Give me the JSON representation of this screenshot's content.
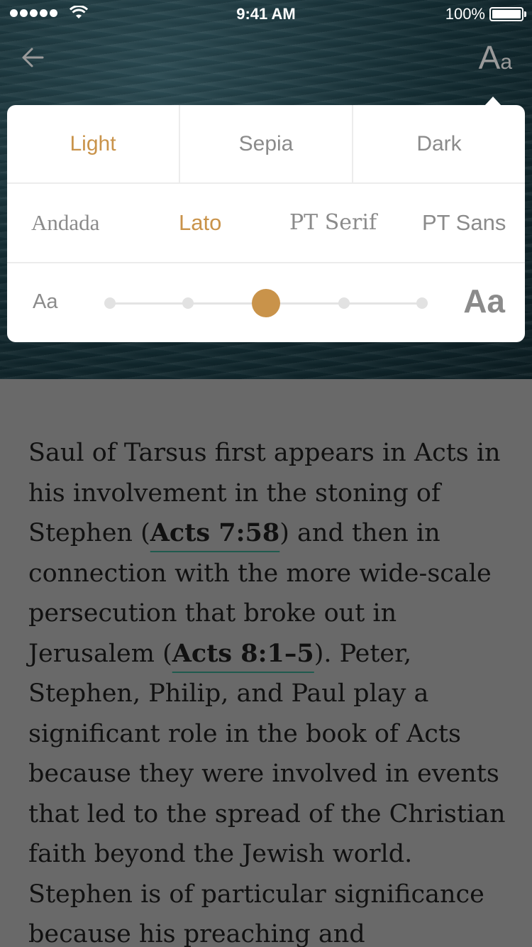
{
  "status_bar": {
    "time": "9:41 AM",
    "battery": "100%"
  },
  "nav": {
    "back_icon": "arrow-left-icon",
    "font_settings_label_big": "A",
    "font_settings_label_small": "a"
  },
  "settings": {
    "themes": [
      {
        "label": "Light",
        "active": true
      },
      {
        "label": "Sepia",
        "active": false
      },
      {
        "label": "Dark",
        "active": false
      }
    ],
    "fonts": [
      {
        "label": "Andada",
        "active": false
      },
      {
        "label": "Lato",
        "active": true
      },
      {
        "label": "PT Serif",
        "active": false
      },
      {
        "label": "PT Sans",
        "active": false
      }
    ],
    "size": {
      "small_label": "Aa",
      "large_label": "Aa",
      "steps": 5,
      "selected_step": 3
    },
    "accent_color": "#c9934a"
  },
  "article": {
    "p1": "Saul of Tarsus first appears in Acts in his involvement in the stoning of Stephen (",
    "ref1": "Acts 7:58",
    "p2": ") and then in connection with the more wide-scale persecution that broke out in Jerusalem (",
    "ref2": "Acts 8:1–5",
    "p3": "). Peter, Stephen, Philip, and Paul play a significant role in the book of Acts because they were involved in events that led to the spread of the Christian faith beyond the Jewish world. Stephen is of particular significance because his preaching and"
  }
}
